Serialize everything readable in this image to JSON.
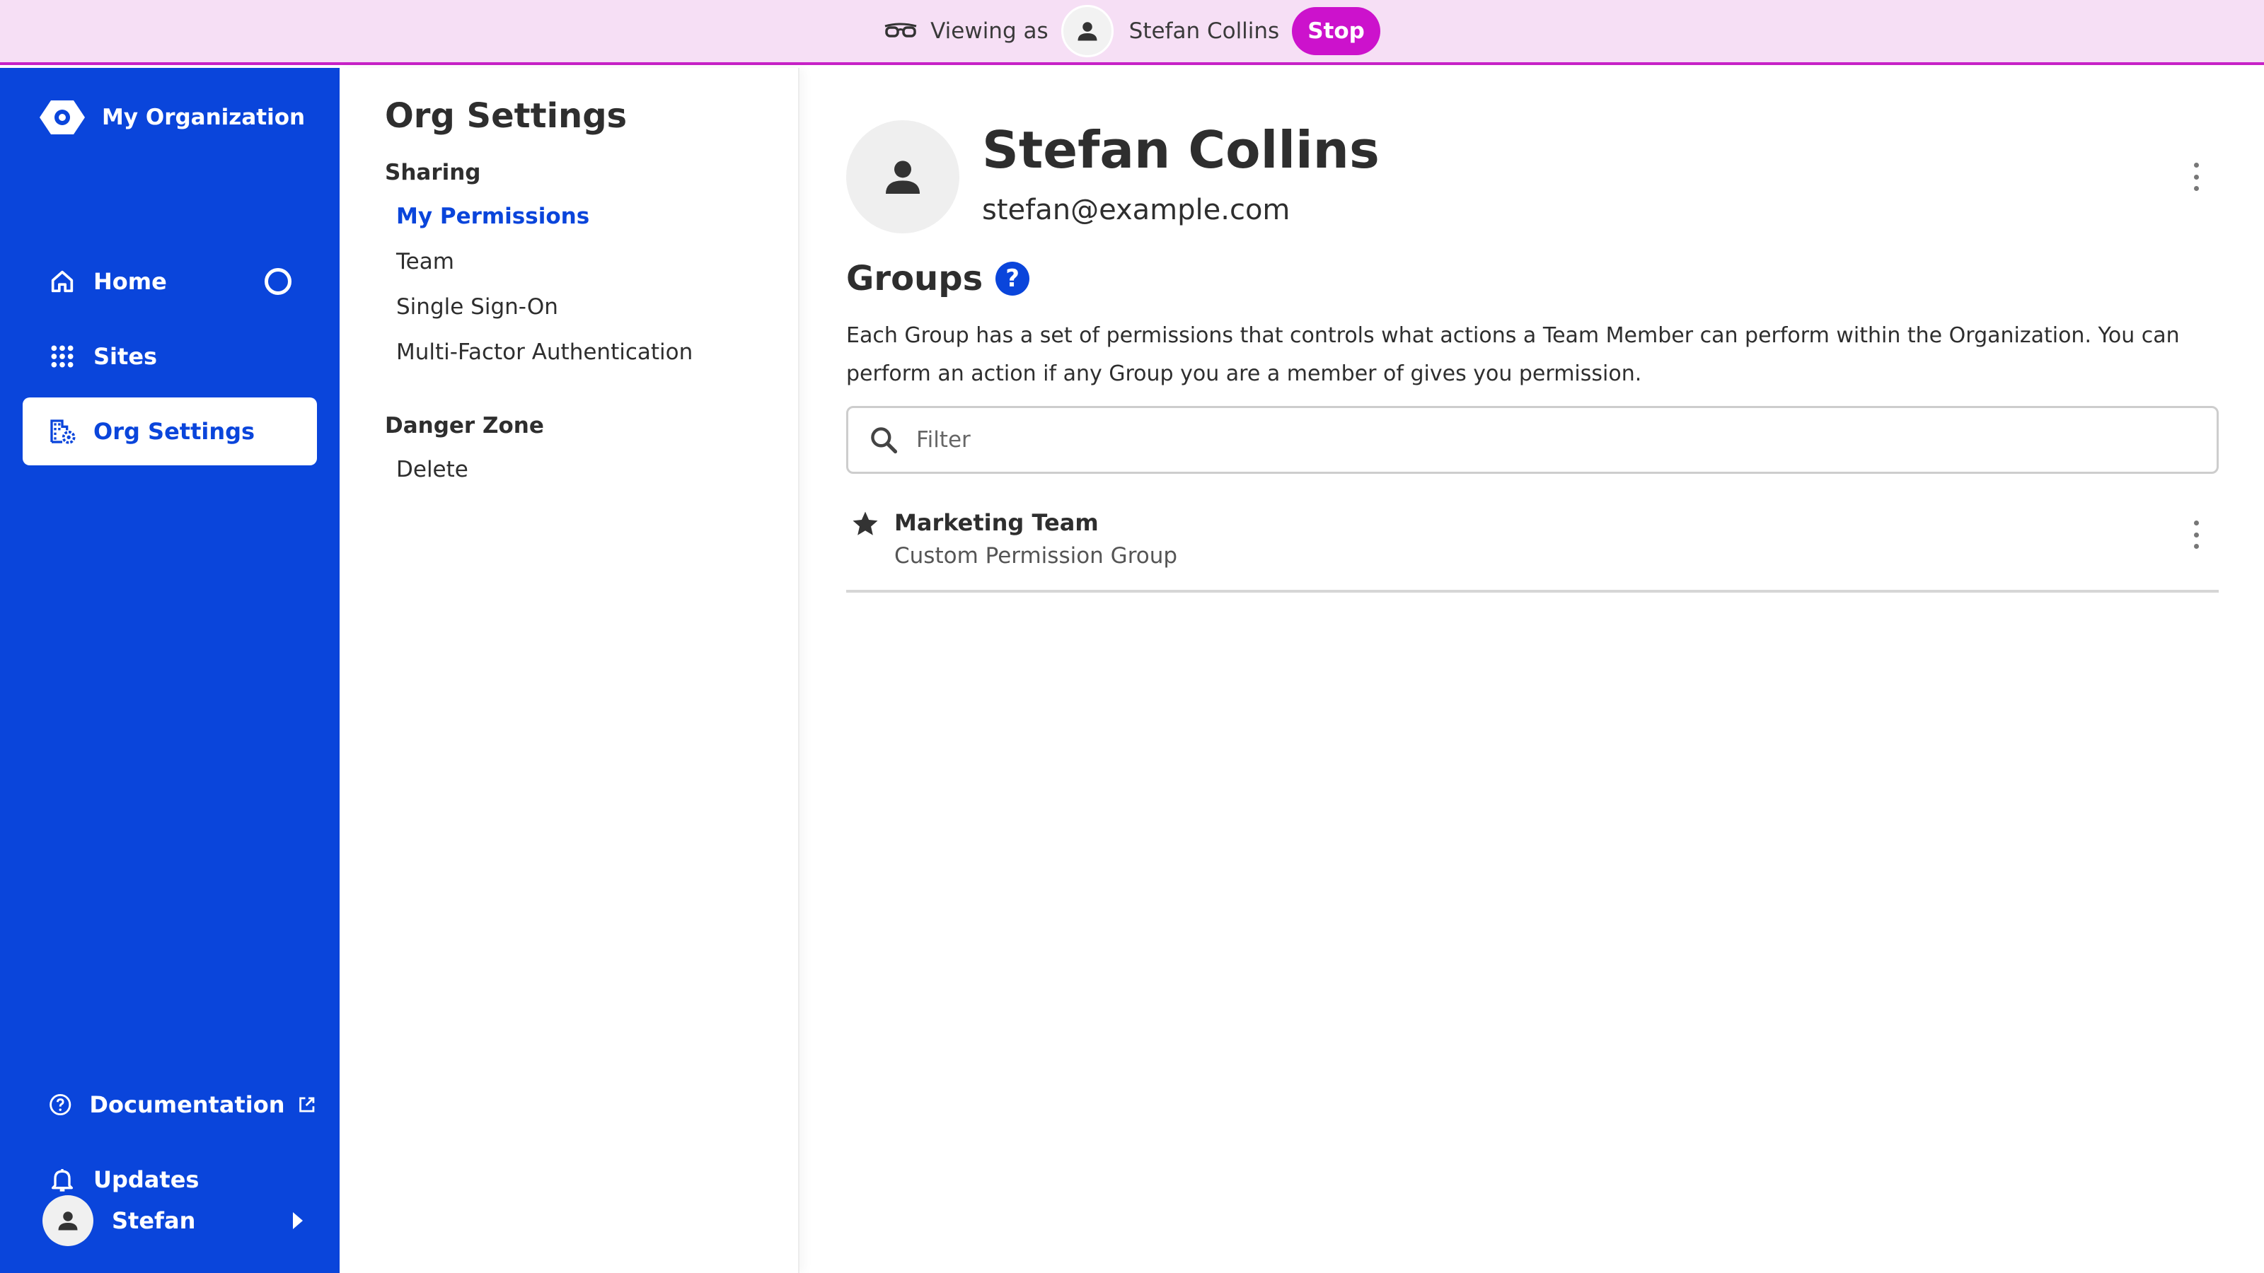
{
  "banner": {
    "viewing_as_label": "Viewing as",
    "user_name": "Stefan Collins",
    "stop_label": "Stop",
    "bg_color": "#f6dff5",
    "accent_color": "#cc12cc"
  },
  "sidebar": {
    "org_name": "My Organization",
    "brand_color": "#0a45db",
    "nav": [
      {
        "label": "Home",
        "icon": "home-icon"
      },
      {
        "label": "Sites",
        "icon": "grid-icon"
      },
      {
        "label": "Org Settings",
        "icon": "building-gear-icon",
        "active": true
      }
    ],
    "footer": [
      {
        "label": "Documentation",
        "icon": "help-circle-icon"
      },
      {
        "label": "Updates",
        "icon": "bell-icon"
      }
    ],
    "user_label": "Stefan"
  },
  "subnav": {
    "title": "Org Settings",
    "sections": [
      {
        "heading": "Sharing",
        "links": [
          "My Permissions",
          "Team",
          "Single Sign-On",
          "Multi-Factor Authentication"
        ]
      },
      {
        "heading": "Danger Zone",
        "links": [
          "Delete"
        ]
      }
    ],
    "active_link": "My Permissions"
  },
  "profile": {
    "name": "Stefan Collins",
    "email": "stefan@example.com"
  },
  "groups": {
    "title": "Groups",
    "help_glyph": "?",
    "description": "Each Group has a set of permissions that controls what actions a Team Member can perform within the Organization. You can perform an action if any Group you are a member of gives you permission.",
    "filter_placeholder": "Filter",
    "items": [
      {
        "name": "Marketing Team",
        "type": "Custom Permission Group",
        "starred": true
      }
    ]
  }
}
